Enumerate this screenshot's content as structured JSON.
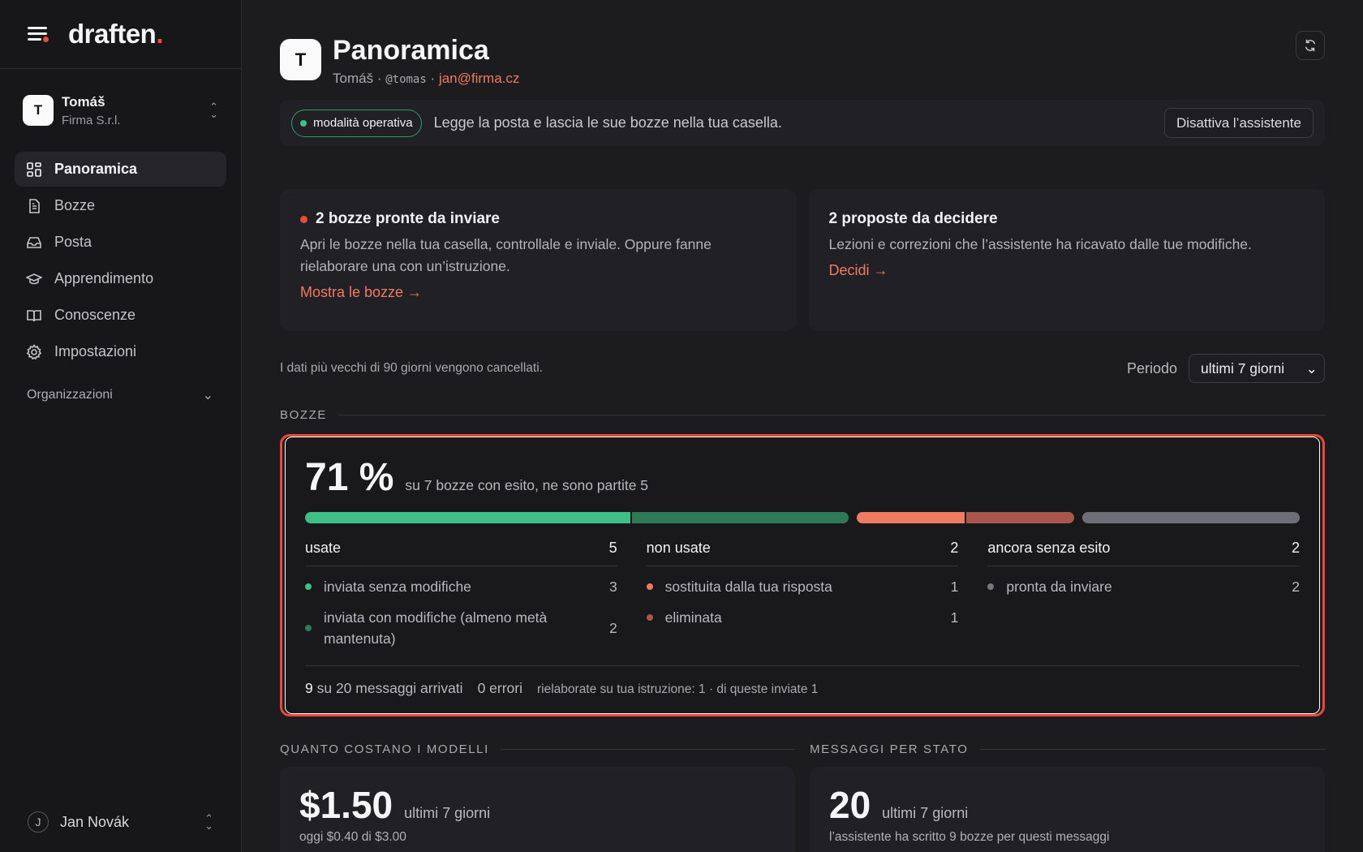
{
  "brand": {
    "name": "draften",
    "dot": "."
  },
  "workspace": {
    "initial": "T",
    "name": "Tomáš",
    "org": "Firma S.r.l."
  },
  "nav": [
    {
      "label": "Panoramica",
      "icon": "dashboard-icon",
      "active": true
    },
    {
      "label": "Bozze",
      "icon": "document-icon"
    },
    {
      "label": "Posta",
      "icon": "inbox-icon"
    },
    {
      "label": "Apprendimento",
      "icon": "graduation-cap-icon"
    },
    {
      "label": "Conoscenze",
      "icon": "book-icon"
    },
    {
      "label": "Impostazioni",
      "icon": "gear-icon"
    }
  ],
  "organizations_label": "Organizzazioni",
  "user": {
    "initial": "J",
    "name": "Jan Novák"
  },
  "header": {
    "initial": "T",
    "title": "Panoramica",
    "name": "Tomáš",
    "sep": "·",
    "handle": "@tomas",
    "email": "jan@firma.cz"
  },
  "mode": {
    "pill": "modalità operativa",
    "text": "Legge la posta e lascia le sue bozze nella tua casella.",
    "button": "Disattiva l’assistente"
  },
  "cards": [
    {
      "title": "2 bozze pronte da inviare",
      "text": "Apri le bozze nella tua casella, controllale e inviale. Oppure fanne rielaborare una con un’istruzione.",
      "link": "Mostra le bozze →"
    },
    {
      "title": "2 proposte da decidere",
      "text": "Lezioni e correzioni che l’assistente ha ricavato dalle tue modifiche.",
      "link": "Decidi →"
    }
  ],
  "retention_note": "I dati più vecchi di 90 giorni vengono cancellati.",
  "period": {
    "label": "Periodo",
    "value": "ultimi 7 giorni"
  },
  "drafts": {
    "section": "BOZZE",
    "percent": "71 %",
    "summary": "su 7 bozze con esito, ne sono partite 5",
    "bar": [
      {
        "name": "inviata senza modifiche",
        "value": 3,
        "color": "#3fbf85"
      },
      {
        "name": "inviata con modifiche",
        "value": 2,
        "color": "#2f7a56"
      },
      {
        "name": "sostituita",
        "value": 1,
        "color": "#f07a62"
      },
      {
        "name": "eliminata",
        "value": 1,
        "color": "#a9574c"
      },
      {
        "name": "pronta da inviare",
        "value": 2,
        "color": "#6e6e76"
      }
    ],
    "columns": [
      {
        "title": "usate",
        "total": "5",
        "rows": [
          {
            "label": "inviata senza modifiche",
            "count": "3",
            "color": "#3fbf85"
          },
          {
            "label": "inviata con modifiche (almeno metà mantenuta)",
            "count": "2",
            "color": "#2f7a56"
          }
        ]
      },
      {
        "title": "non usate",
        "total": "2",
        "rows": [
          {
            "label": "sostituita dalla tua risposta",
            "count": "1",
            "color": "#f07a62"
          },
          {
            "label": "eliminata",
            "count": "1",
            "color": "#a9574c"
          }
        ]
      },
      {
        "title": "ancora senza esito",
        "total": "2",
        "rows": [
          {
            "label": "pronta da inviare",
            "count": "2",
            "color": "#77777e"
          }
        ]
      }
    ],
    "footer": {
      "arrived_count": "9",
      "arrived_text": "su 20 messaggi arrivati",
      "errors": "0 errori",
      "reworked": "rielaborate su tua istruzione: 1 · di queste inviate 1"
    }
  },
  "costs": {
    "section": "QUANTO COSTANO I MODELLI",
    "amount": "$1.50",
    "period": "ultimi 7 giorni",
    "sub": "oggi $0.40 di $3.00"
  },
  "messages": {
    "section": "MESSAGGI PER STATO",
    "count": "20",
    "period": "ultimi 7 giorni",
    "sub": "l’assistente ha scritto 9 bozze per questi messaggi"
  }
}
